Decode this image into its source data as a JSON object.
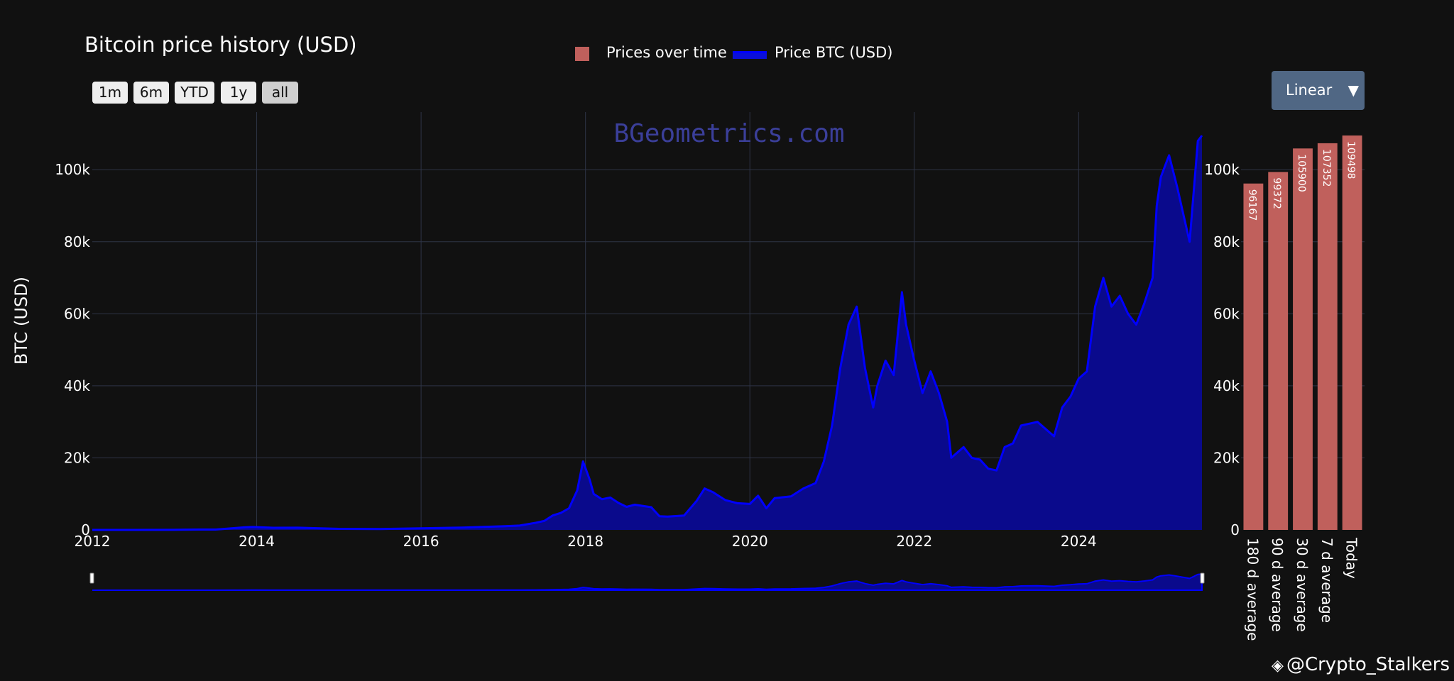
{
  "title": "Bitcoin price history (USD)",
  "range_buttons": [
    "1m",
    "6m",
    "YTD",
    "1y",
    "all"
  ],
  "legend": {
    "bar_label": "Prices over time",
    "line_label": "Price BTC (USD)"
  },
  "scale_dropdown": {
    "label": "Linear",
    "arrow": "▼"
  },
  "watermark": "BGeometrics.com",
  "credit": {
    "icon": "binance-logo-icon",
    "text": "@Crypto_Stalkers"
  },
  "colors": {
    "line": "#0000ff",
    "fill": "#0a0a8c",
    "bar": "#c0605c",
    "grid": "#2e3446",
    "background": "#111111"
  },
  "chart_data": [
    {
      "type": "area",
      "ylabel": "BTC (USD)",
      "xlim": [
        2012,
        2025.5
      ],
      "ylim": [
        0,
        116000
      ],
      "x_ticks": [
        "2012",
        "2014",
        "2016",
        "2018",
        "2020",
        "2022",
        "2024"
      ],
      "y_ticks": [
        "0",
        "20k",
        "40k",
        "60k",
        "80k",
        "100k"
      ],
      "grid": true,
      "legend_position": "top-center",
      "series": [
        {
          "name": "Price BTC (USD)",
          "x": [
            2012.0,
            2012.5,
            2013.0,
            2013.3,
            2013.5,
            2013.85,
            2013.95,
            2014.2,
            2014.5,
            2015.0,
            2015.5,
            2016.0,
            2016.5,
            2017.0,
            2017.2,
            2017.4,
            2017.5,
            2017.6,
            2017.7,
            2017.8,
            2017.9,
            2017.97,
            2018.05,
            2018.1,
            2018.2,
            2018.3,
            2018.4,
            2018.5,
            2018.6,
            2018.8,
            2018.9,
            2019.0,
            2019.2,
            2019.35,
            2019.45,
            2019.55,
            2019.7,
            2019.85,
            2020.0,
            2020.1,
            2020.2,
            2020.3,
            2020.5,
            2020.65,
            2020.8,
            2020.9,
            2021.0,
            2021.1,
            2021.2,
            2021.3,
            2021.4,
            2021.5,
            2021.55,
            2021.65,
            2021.75,
            2021.85,
            2021.9,
            2022.0,
            2022.1,
            2022.2,
            2022.3,
            2022.4,
            2022.45,
            2022.6,
            2022.7,
            2022.8,
            2022.9,
            2023.0,
            2023.1,
            2023.2,
            2023.3,
            2023.5,
            2023.7,
            2023.8,
            2023.9,
            2024.0,
            2024.1,
            2024.2,
            2024.3,
            2024.4,
            2024.5,
            2024.6,
            2024.7,
            2024.8,
            2024.9,
            2024.95,
            2025.0,
            2025.1,
            2025.2,
            2025.3,
            2025.35,
            2025.4,
            2025.45,
            2025.5
          ],
          "y": [
            5,
            7,
            13,
            100,
            90,
            700,
            800,
            600,
            620,
            300,
            260,
            430,
            650,
            1000,
            1200,
            2000,
            2500,
            4000,
            4700,
            6000,
            11000,
            19000,
            14000,
            10000,
            8500,
            9000,
            7500,
            6400,
            7000,
            6300,
            3800,
            3700,
            4000,
            8000,
            11500,
            10500,
            8300,
            7400,
            7200,
            9500,
            6000,
            8800,
            9300,
            11500,
            13000,
            19000,
            29000,
            45000,
            57000,
            62000,
            45000,
            34000,
            40000,
            47000,
            43000,
            66000,
            57000,
            47000,
            38000,
            44000,
            38000,
            30000,
            20000,
            23000,
            20000,
            19500,
            17000,
            16500,
            23000,
            24000,
            29000,
            30000,
            26000,
            34000,
            37000,
            42000,
            44000,
            62000,
            70000,
            62000,
            65000,
            60000,
            57000,
            63000,
            70000,
            90000,
            98000,
            104000,
            95000,
            85000,
            80000,
            94000,
            108000,
            109498
          ]
        }
      ]
    },
    {
      "type": "bar",
      "categories": [
        "180 d average",
        "90 d average",
        "30 d average",
        "7 d average",
        "Today"
      ],
      "values": [
        96167,
        99372,
        105900,
        107352,
        109498
      ],
      "value_labels": [
        "96167",
        "99372",
        "105900",
        "107352",
        "109498"
      ],
      "series_name": "Prices over time",
      "ylim": [
        0,
        116000
      ],
      "y_ticks": [
        "0",
        "20k",
        "40k",
        "60k",
        "80k",
        "100k"
      ]
    }
  ]
}
